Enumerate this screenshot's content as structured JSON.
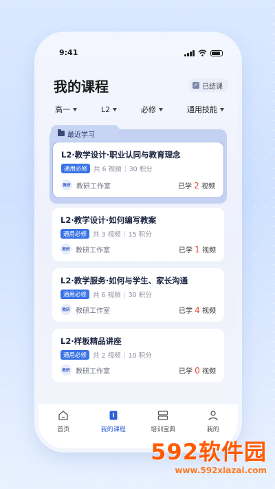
{
  "status": {
    "time": "9:41"
  },
  "header": {
    "title": "我的课程",
    "done_label": "已结课"
  },
  "filters": [
    {
      "label": "高一"
    },
    {
      "label": "L2"
    },
    {
      "label": "必修"
    },
    {
      "label": "通用技能"
    }
  ],
  "recent": {
    "label": "最近学习"
  },
  "courses": [
    {
      "title": "L2·教学设计·职业认同与教育理念",
      "tag": "通用必修",
      "videos": "共 6 视频",
      "points": "30 积分",
      "studio": "教研工作室",
      "logo": "教研",
      "learned_prefix": "已学",
      "learned": "2",
      "learned_suffix": "视频"
    },
    {
      "title": "L2·教学设计·如何编写教案",
      "tag": "通用必修",
      "videos": "共 3 视频",
      "points": "15 积分",
      "studio": "教研工作室",
      "logo": "教研",
      "learned_prefix": "已学",
      "learned": "1",
      "learned_suffix": "视频"
    },
    {
      "title": "L2·教学服务·如何与学生、家长沟通",
      "tag": "通用必修",
      "videos": "共 6 视频",
      "points": "30 积分",
      "studio": "教研工作室",
      "logo": "教研",
      "learned_prefix": "已学",
      "learned": "4",
      "learned_suffix": "视频"
    },
    {
      "title": "L2·样板精品讲座",
      "tag": "通用必修",
      "videos": "共 2 视频",
      "points": "10 积分",
      "studio": "教研工作室",
      "logo": "教研",
      "learned_prefix": "已学",
      "learned": "0",
      "learned_suffix": "视频"
    }
  ],
  "tabbar": [
    {
      "label": "首页",
      "icon": "home-icon"
    },
    {
      "label": "我的课程",
      "icon": "course-icon"
    },
    {
      "label": "培训宝典",
      "icon": "book-icon"
    },
    {
      "label": "我的",
      "icon": "user-icon"
    }
  ],
  "watermark": {
    "brand": "592软件园",
    "url": "www.592xiazai.com"
  },
  "colors": {
    "accent": "#2c5fd8",
    "tag": "#3a73e6",
    "highlight": "#e34b3b",
    "watermark": "#ff5a00"
  }
}
